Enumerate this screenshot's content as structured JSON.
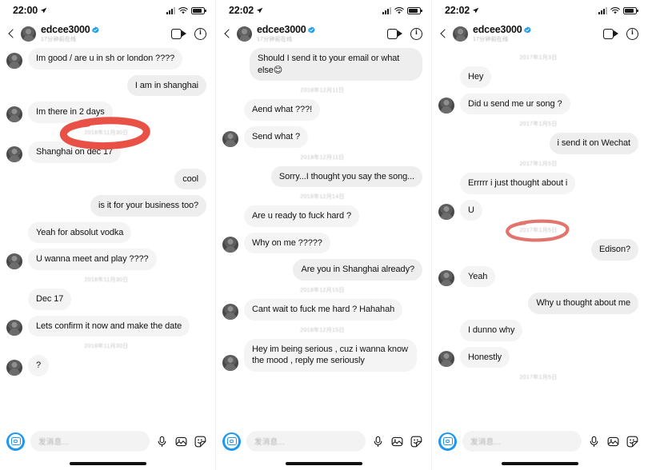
{
  "app": {
    "name": "Instagram Direct Messages",
    "screens": [
      {
        "id": "screen-left",
        "status": {
          "time": "22:00",
          "location_icon": "location-arrow-icon",
          "signal_icon": "cellular-signal-icon",
          "wifi_icon": "wifi-icon",
          "battery_icon": "battery-icon"
        },
        "header": {
          "back_icon": "back-chevron-icon",
          "avatar": "user-avatar",
          "username": "edcee3000",
          "verified_icon": "verified-badge-icon",
          "subtitle": "17分钟前在线",
          "video_call_icon": "video-camera-icon",
          "info_icon": "info-icon"
        },
        "messages": [
          {
            "type": "message",
            "side": "them",
            "text": "Im good / are u in sh or london ????",
            "avatar": true
          },
          {
            "type": "message",
            "side": "me",
            "text": "I am in shanghai"
          },
          {
            "type": "message",
            "side": "them",
            "text": "Im there in 2 days",
            "avatar": true
          },
          {
            "type": "daystamp",
            "text": "2018年11月30日",
            "annotated": true
          },
          {
            "type": "message",
            "side": "them",
            "text": "Shanghai on dec 17",
            "avatar": true
          },
          {
            "type": "message",
            "side": "me",
            "text": "cool"
          },
          {
            "type": "message",
            "side": "me",
            "text": "is it for your business too?"
          },
          {
            "type": "message",
            "side": "them",
            "text": "Yeah for absolut vodka",
            "avatar": false
          },
          {
            "type": "message",
            "side": "them",
            "text": "U wanna meet and play ????",
            "avatar": true
          },
          {
            "type": "daystamp",
            "text": "2018年11月30日"
          },
          {
            "type": "message",
            "side": "them",
            "text": "Dec 17",
            "avatar": false
          },
          {
            "type": "message",
            "side": "them",
            "text": "Lets confirm it now and make the date",
            "avatar": true
          },
          {
            "type": "daystamp",
            "text": "2018年11月30日"
          },
          {
            "type": "message",
            "side": "them",
            "text": "?",
            "avatar": true
          }
        ],
        "composer": {
          "camera_icon": "camera-icon",
          "placeholder": "发消息...",
          "mic_icon": "microphone-icon",
          "photo_icon": "photo-library-icon",
          "sticker_icon": "sticker-icon"
        },
        "home_indicator": "home-indicator"
      },
      {
        "id": "screen-middle",
        "status": {
          "time": "22:02",
          "location_icon": "location-arrow-icon",
          "signal_icon": "cellular-signal-icon",
          "wifi_icon": "wifi-icon",
          "battery_icon": "battery-icon"
        },
        "header": {
          "back_icon": "back-chevron-icon",
          "avatar": "user-avatar",
          "username": "edcee3000",
          "verified_icon": "verified-badge-icon",
          "subtitle": "17分钟前在线",
          "video_call_icon": "video-camera-icon",
          "info_icon": "info-icon"
        },
        "messages": [
          {
            "type": "message",
            "side": "me",
            "text": "Should I send it to your email or what else😊"
          },
          {
            "type": "daystamp",
            "text": "2018年12月11日"
          },
          {
            "type": "message",
            "side": "them",
            "text": "Aend what ???!",
            "avatar": false
          },
          {
            "type": "message",
            "side": "them",
            "text": "Send what ?",
            "avatar": true
          },
          {
            "type": "daystamp",
            "text": "2018年12月11日"
          },
          {
            "type": "message",
            "side": "me",
            "text": "Sorry...I thought you say the song..."
          },
          {
            "type": "daystamp",
            "text": "2018年12月14日"
          },
          {
            "type": "message",
            "side": "them",
            "text": "Are u ready to fuck hard ?",
            "avatar": false
          },
          {
            "type": "message",
            "side": "them",
            "text": "Why on me ?????",
            "avatar": true
          },
          {
            "type": "message",
            "side": "me",
            "text": "Are you in Shanghai already?"
          },
          {
            "type": "daystamp",
            "text": "2018年12月15日"
          },
          {
            "type": "message",
            "side": "them",
            "text": "Cant wait to fuck me hard ? Hahahah",
            "avatar": true
          },
          {
            "type": "daystamp",
            "text": "2018年12月15日"
          },
          {
            "type": "message",
            "side": "them",
            "text": "Hey im being serious , cuz i wanna know the mood , reply me seriously",
            "avatar": true
          }
        ],
        "composer": {
          "camera_icon": "camera-icon",
          "placeholder": "发消息...",
          "mic_icon": "microphone-icon",
          "photo_icon": "photo-library-icon",
          "sticker_icon": "sticker-icon"
        },
        "home_indicator": "home-indicator"
      },
      {
        "id": "screen-right",
        "status": {
          "time": "22:02",
          "location_icon": "location-arrow-icon",
          "signal_icon": "cellular-signal-icon",
          "wifi_icon": "wifi-icon",
          "battery_icon": "battery-icon"
        },
        "header": {
          "back_icon": "back-chevron-icon",
          "avatar": "user-avatar",
          "username": "edcee3000",
          "verified_icon": "verified-badge-icon",
          "subtitle": "17分钟前在线",
          "video_call_icon": "video-camera-icon",
          "info_icon": "info-icon"
        },
        "messages": [
          {
            "type": "daystamp",
            "text": "2017年1月3日"
          },
          {
            "type": "message",
            "side": "them",
            "text": "Hey",
            "avatar": false
          },
          {
            "type": "message",
            "side": "them",
            "text": "Did u send me ur song ?",
            "avatar": true
          },
          {
            "type": "daystamp",
            "text": "2017年1月5日"
          },
          {
            "type": "message",
            "side": "me",
            "text": "i send it on Wechat"
          },
          {
            "type": "daystamp",
            "text": "2017年1月5日"
          },
          {
            "type": "message",
            "side": "them",
            "text": "Errrrr i just thought about i",
            "avatar": false
          },
          {
            "type": "message",
            "side": "them",
            "text": "U",
            "avatar": true
          },
          {
            "type": "daystamp",
            "text": "2017年1月5日",
            "annotated": true
          },
          {
            "type": "message",
            "side": "me",
            "text": "Edison?"
          },
          {
            "type": "message",
            "side": "them",
            "text": "Yeah",
            "avatar": true
          },
          {
            "type": "message",
            "side": "me",
            "text": "Why u thought about me"
          },
          {
            "type": "message",
            "side": "them",
            "text": "I dunno why",
            "avatar": false
          },
          {
            "type": "message",
            "side": "them",
            "text": "Honestly",
            "avatar": true
          },
          {
            "type": "daystamp",
            "text": "2017年1月5日"
          }
        ],
        "composer": {
          "camera_icon": "camera-icon",
          "placeholder": "发消息...",
          "mic_icon": "microphone-icon",
          "photo_icon": "photo-library-icon",
          "sticker_icon": "sticker-icon"
        },
        "home_indicator": "home-indicator"
      }
    ],
    "annotations": [
      {
        "name": "red-circle-annotation-left",
        "color": "#e8483c",
        "shape": "hand-drawn-oval"
      },
      {
        "name": "red-circle-annotation-right",
        "color": "#d9534a",
        "shape": "hand-drawn-oval"
      }
    ],
    "colors": {
      "accent_blue": "#1f97f0",
      "verified_blue": "#1c9cf0",
      "bubble_them": "#f4f4f4",
      "bubble_me": "#eeeeee",
      "annotation_red": "#e8483c"
    }
  }
}
